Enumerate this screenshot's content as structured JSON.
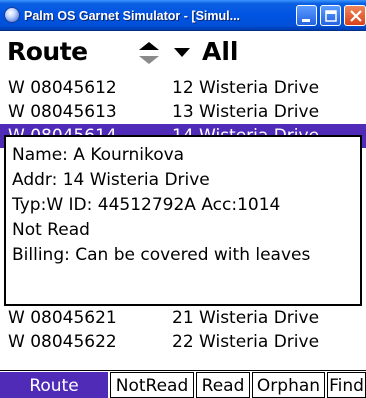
{
  "window": {
    "title": "Palm OS Garnet Simulator - [Simul..."
  },
  "header": {
    "title": "Route",
    "filter_value": "All"
  },
  "rows": [
    {
      "meter": "W 08045612",
      "address": "12 Wisteria Drive"
    },
    {
      "meter": "W 08045613",
      "address": "13 Wisteria Drive"
    },
    {
      "meter": "W 08045614",
      "address": "14 Wisteria Drive"
    },
    {
      "meter": "W 08045621",
      "address": "21 Wisteria Drive"
    },
    {
      "meter": "W 08045622",
      "address": "22 Wisteria Drive"
    }
  ],
  "details": {
    "name": "Name: A Kournikova",
    "addr": "Addr: 14 Wisteria Drive",
    "typ": "Typ:W ID: 44512792A Acc:1014",
    "status": "Not Read",
    "billing": "Billing: Can be covered with leaves"
  },
  "tabs": [
    {
      "label": "Route"
    },
    {
      "label": "NotRead"
    },
    {
      "label": "Read"
    },
    {
      "label": "Orphan"
    },
    {
      "label": "Find"
    }
  ],
  "colors": {
    "selection": "#4f2bb7",
    "titlebar": "#0054e3",
    "close_button": "#d8421b"
  }
}
